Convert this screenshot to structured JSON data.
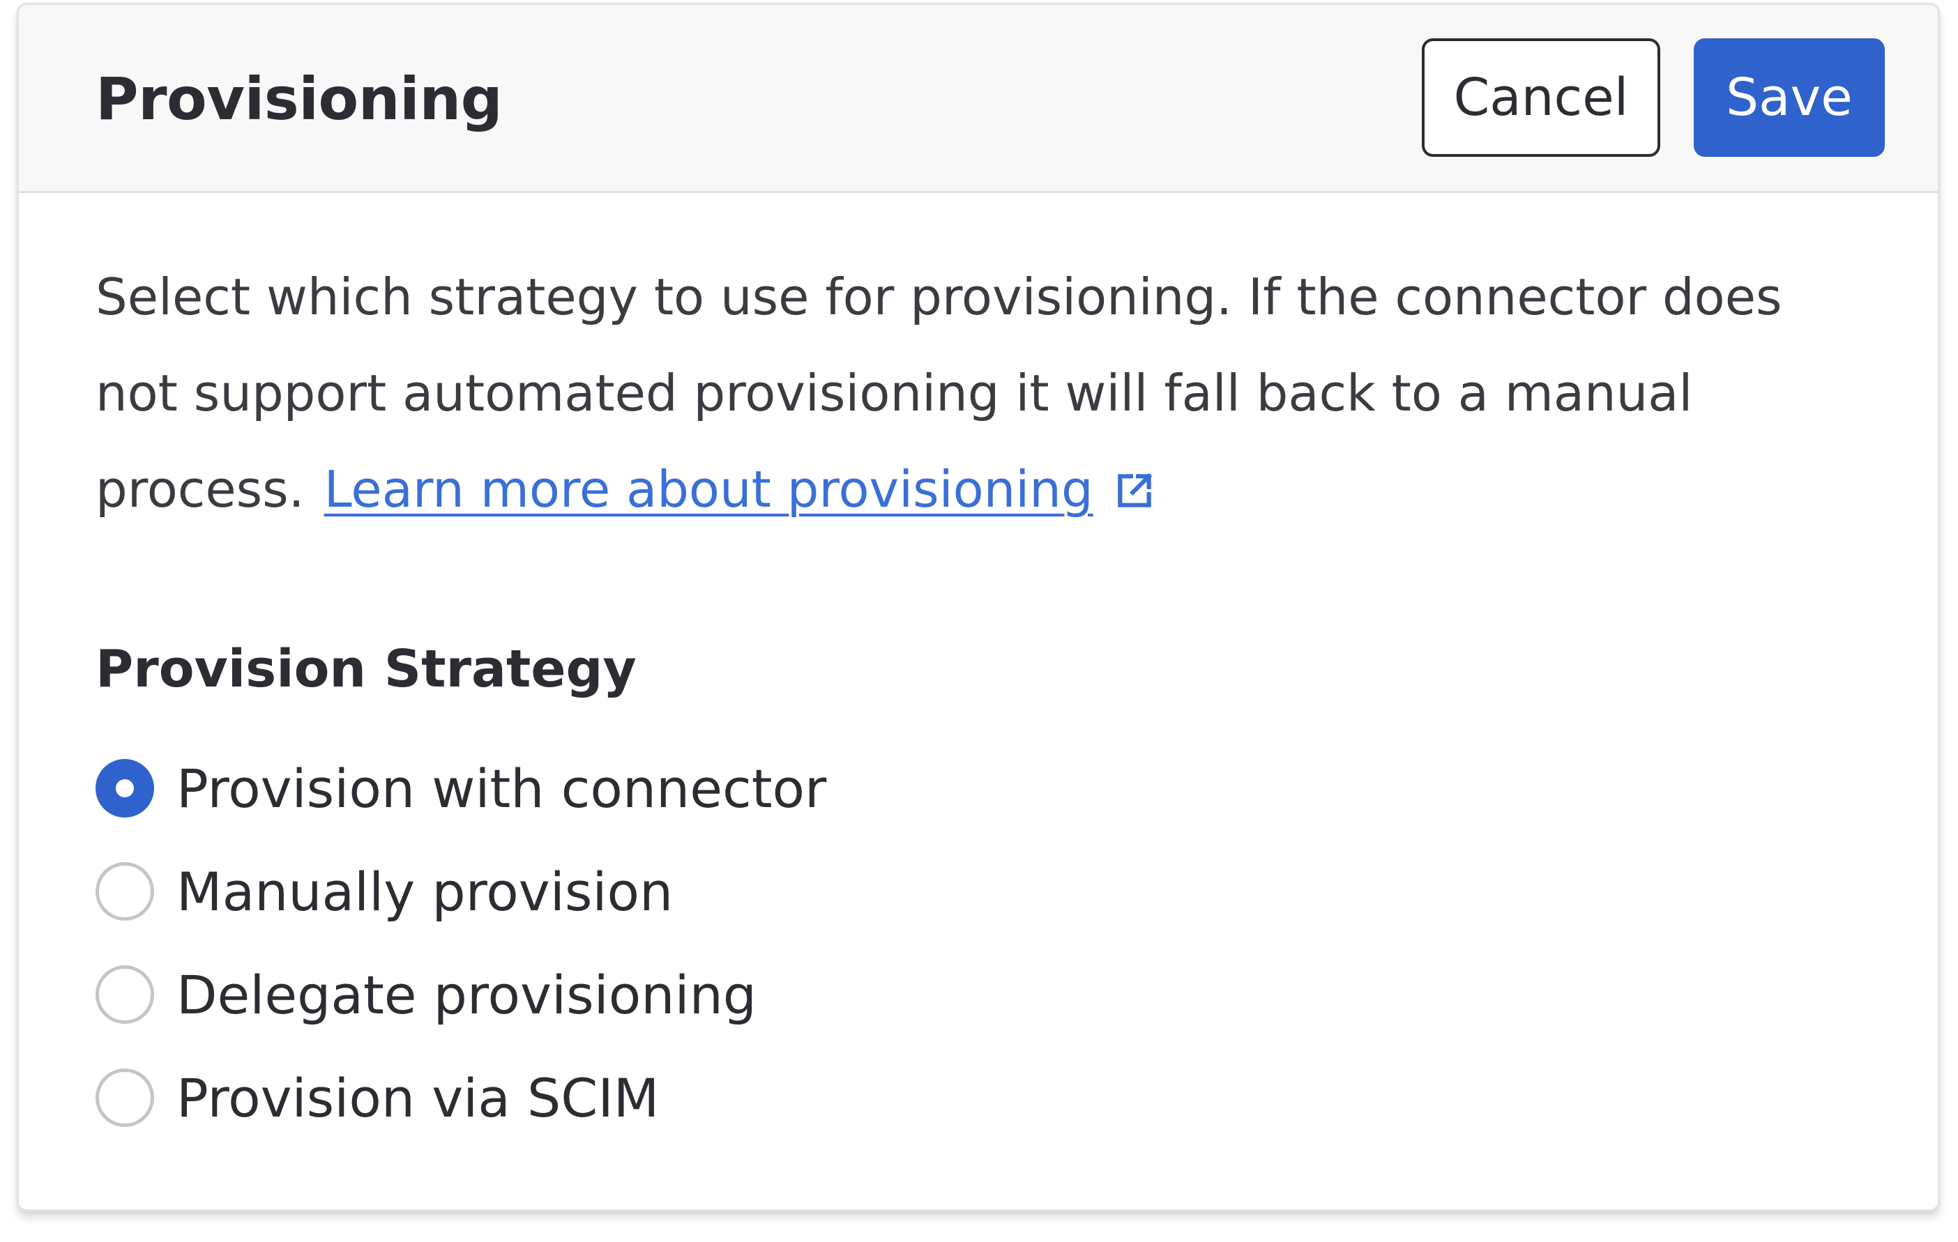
{
  "panel": {
    "title": "Provisioning",
    "cancel_label": "Cancel",
    "save_label": "Save"
  },
  "body": {
    "description": "Select which strategy to use for provisioning. If the connector does not support automated provisioning it will fall back to a manual process.",
    "learn_more_link": "Learn more about provisioning",
    "link_icon": "external-link-icon",
    "strategy_label": "Provision Strategy"
  },
  "strategy_options": [
    {
      "label": "Provision with connector",
      "selected": true
    },
    {
      "label": "Manually provision",
      "selected": false
    },
    {
      "label": "Delegate provisioning",
      "selected": false
    },
    {
      "label": "Provision via SCIM",
      "selected": false
    }
  ],
  "colors": {
    "accent": "#2f62cc",
    "link": "#3a6fd8",
    "header_bg": "#f8f8f9"
  }
}
